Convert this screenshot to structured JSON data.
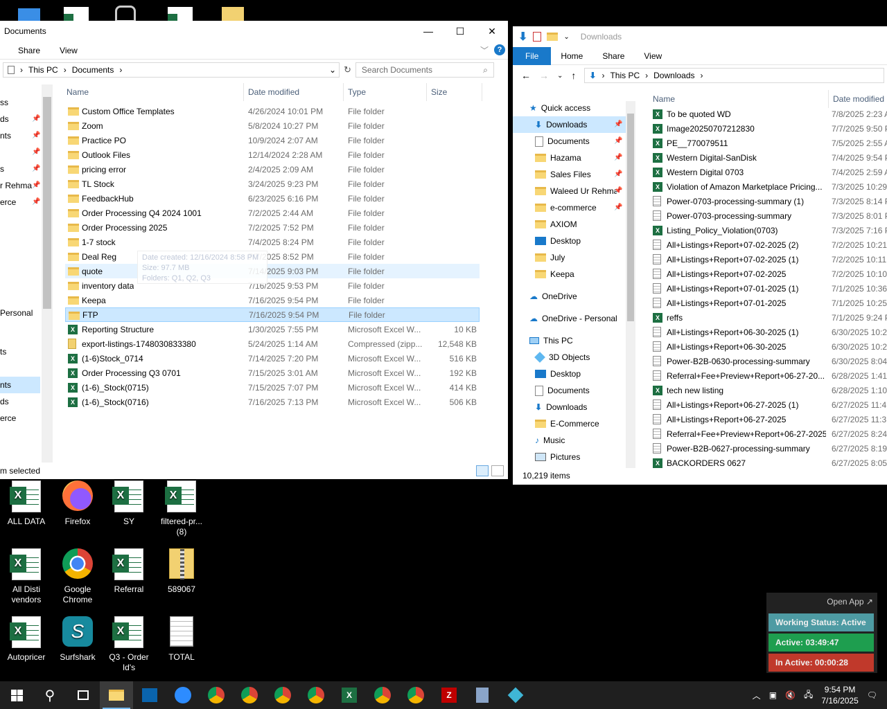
{
  "documents_window": {
    "title": "Documents",
    "tabs": [
      "Share",
      "View"
    ],
    "breadcrumb": [
      "This PC",
      "Documents"
    ],
    "search_placeholder": "Search Documents",
    "nav_partial": [
      "ss",
      "ds",
      "nts",
      "s",
      "r Rehma",
      "erce",
      "Personal",
      "ts",
      "nts",
      "ds",
      "erce"
    ],
    "columns": [
      "Name",
      "Date modified",
      "Type",
      "Size"
    ],
    "files": [
      {
        "name": "Custom Office Templates",
        "date": "4/26/2024 10:01 PM",
        "type": "File folder",
        "size": "",
        "icon": "folder-icon"
      },
      {
        "name": "Zoom",
        "date": "5/8/2024 10:27 PM",
        "type": "File folder",
        "size": "",
        "icon": "folder-icon"
      },
      {
        "name": "Practice PO",
        "date": "10/9/2024 2:07 AM",
        "type": "File folder",
        "size": "",
        "icon": "folder-icon"
      },
      {
        "name": "Outlook Files",
        "date": "12/14/2024 2:28 AM",
        "type": "File folder",
        "size": "",
        "icon": "folder-icon"
      },
      {
        "name": "pricing error",
        "date": "2/4/2025 2:09 AM",
        "type": "File folder",
        "size": "",
        "icon": "folder-icon"
      },
      {
        "name": "TL Stock",
        "date": "3/24/2025 9:23 PM",
        "type": "File folder",
        "size": "",
        "icon": "folder-icon"
      },
      {
        "name": "FeedbackHub",
        "date": "6/23/2025 6:16 PM",
        "type": "File folder",
        "size": "",
        "icon": "folder-icon"
      },
      {
        "name": "Order Processing Q4 2024 1001",
        "date": "7/2/2025 2:44 AM",
        "type": "File folder",
        "size": "",
        "icon": "folder-icon"
      },
      {
        "name": "Order Processing 2025",
        "date": "7/2/2025 7:52 PM",
        "type": "File folder",
        "size": "",
        "icon": "folder-icon"
      },
      {
        "name": "1-7 stock",
        "date": "7/4/2025 8:24 PM",
        "type": "File folder",
        "size": "",
        "icon": "folder-icon"
      },
      {
        "name": "Deal Reg",
        "date": "7/7/2025 8:52 PM",
        "type": "File folder",
        "size": "",
        "icon": "folder-icon"
      },
      {
        "name": "quote",
        "date": "7/14/2025 9:03 PM",
        "type": "File folder",
        "size": "",
        "icon": "folder-icon"
      },
      {
        "name": "inventory data",
        "date": "7/16/2025 9:53 PM",
        "type": "File folder",
        "size": "",
        "icon": "folder-icon"
      },
      {
        "name": "Keepa",
        "date": "7/16/2025 9:54 PM",
        "type": "File folder",
        "size": "",
        "icon": "folder-icon"
      },
      {
        "name": "FTP",
        "date": "7/16/2025 9:54 PM",
        "type": "File folder",
        "size": "",
        "icon": "folder-icon"
      },
      {
        "name": "Reporting Structure",
        "date": "1/30/2025 7:55 PM",
        "type": "Microsoft Excel W...",
        "size": "10 KB",
        "icon": "excel-icon"
      },
      {
        "name": "export-listings-1748030833380",
        "date": "5/24/2025 1:14 AM",
        "type": "Compressed (zipp...",
        "size": "12,548 KB",
        "icon": "zip-icon"
      },
      {
        "name": "(1-6)Stock_0714",
        "date": "7/14/2025 7:20 PM",
        "type": "Microsoft Excel W...",
        "size": "516 KB",
        "icon": "excel-icon"
      },
      {
        "name": "Order Processing Q3 0701",
        "date": "7/15/2025 3:01 AM",
        "type": "Microsoft Excel W...",
        "size": "192 KB",
        "icon": "excel-icon"
      },
      {
        "name": "(1-6)_Stock(0715)",
        "date": "7/15/2025 7:07 PM",
        "type": "Microsoft Excel W...",
        "size": "414 KB",
        "icon": "excel-icon"
      },
      {
        "name": "(1-6)_Stock(0716)",
        "date": "7/16/2025 7:13 PM",
        "type": "Microsoft Excel W...",
        "size": "506 KB",
        "icon": "excel-icon"
      }
    ],
    "tooltip": {
      "created": "Date created: 12/16/2024 8:58 PM",
      "size": "Size: 97.7 MB",
      "folders": "Folders: Q1, Q2, Q3"
    },
    "status": "m selected"
  },
  "downloads_window": {
    "title": "Downloads",
    "tabs": [
      "File",
      "Home",
      "Share",
      "View"
    ],
    "breadcrumb": [
      "This PC",
      "Downloads"
    ],
    "columns": [
      "Name",
      "Date modified"
    ],
    "nav": {
      "quick_access": "Quick access",
      "quick_items": [
        {
          "label": "Downloads",
          "icon": "download-arrow-icon",
          "pinned": true
        },
        {
          "label": "Documents",
          "icon": "documents-icon",
          "pinned": true
        },
        {
          "label": "Hazama",
          "icon": "folder-icon",
          "pinned": true
        },
        {
          "label": "Sales Files",
          "icon": "folder-icon",
          "pinned": true
        },
        {
          "label": "Waleed Ur Rehma",
          "icon": "folder-icon",
          "pinned": true
        },
        {
          "label": "e-commerce",
          "icon": "folder-icon",
          "pinned": true
        },
        {
          "label": "AXIOM",
          "icon": "folder-icon",
          "pinned": false
        },
        {
          "label": "Desktop",
          "icon": "desktop-icon",
          "pinned": false
        },
        {
          "label": "July",
          "icon": "folder-icon",
          "pinned": false
        },
        {
          "label": "Keepa",
          "icon": "folder-icon",
          "pinned": false
        }
      ],
      "onedrive": "OneDrive",
      "onedrive_personal": "OneDrive - Personal",
      "this_pc": "This PC",
      "pc_items": [
        {
          "label": "3D Objects",
          "icon": "3d-objects-icon"
        },
        {
          "label": "Desktop",
          "icon": "desktop-icon"
        },
        {
          "label": "Documents",
          "icon": "documents-icon"
        },
        {
          "label": "Downloads",
          "icon": "download-arrow-icon"
        },
        {
          "label": "E-Commerce",
          "icon": "folder-icon"
        },
        {
          "label": "Music",
          "icon": "music-icon"
        },
        {
          "label": "Pictures",
          "icon": "pictures-icon"
        }
      ]
    },
    "files": [
      {
        "name": "To be quoted WD",
        "date": "7/8/2025 2:23 A",
        "icon": "excel-icon"
      },
      {
        "name": "Image20250707212830",
        "date": "7/7/2025 9:50 P",
        "icon": "excel-icon"
      },
      {
        "name": "PE__770079511",
        "date": "7/5/2025 2:55 A",
        "icon": "excel-icon"
      },
      {
        "name": "Western Digital-SanDisk",
        "date": "7/4/2025 9:54 P",
        "icon": "excel-icon"
      },
      {
        "name": "Western Digital 0703",
        "date": "7/4/2025 2:59 A",
        "icon": "excel-icon"
      },
      {
        "name": "Violation of Amazon Marketplace Pricing...",
        "date": "7/3/2025 10:29",
        "icon": "excel-icon"
      },
      {
        "name": "Power-0703-processing-summary (1)",
        "date": "7/3/2025 8:14 P",
        "icon": "text-icon"
      },
      {
        "name": "Power-0703-processing-summary",
        "date": "7/3/2025 8:01 P",
        "icon": "text-icon"
      },
      {
        "name": "Listing_Policy_Violation(0703)",
        "date": "7/3/2025 7:16 P",
        "icon": "excel-icon"
      },
      {
        "name": "All+Listings+Report+07-02-2025 (2)",
        "date": "7/2/2025 10:21",
        "icon": "text-icon"
      },
      {
        "name": "All+Listings+Report+07-02-2025 (1)",
        "date": "7/2/2025 10:11",
        "icon": "text-icon"
      },
      {
        "name": "All+Listings+Report+07-02-2025",
        "date": "7/2/2025 10:10",
        "icon": "text-icon"
      },
      {
        "name": "All+Listings+Report+07-01-2025 (1)",
        "date": "7/1/2025 10:36",
        "icon": "text-icon"
      },
      {
        "name": "All+Listings+Report+07-01-2025",
        "date": "7/1/2025 10:25",
        "icon": "text-icon"
      },
      {
        "name": "reffs",
        "date": "7/1/2025 9:24 P",
        "icon": "excel-icon"
      },
      {
        "name": "All+Listings+Report+06-30-2025 (1)",
        "date": "6/30/2025 10:2",
        "icon": "text-icon"
      },
      {
        "name": "All+Listings+Report+06-30-2025",
        "date": "6/30/2025 10:2",
        "icon": "text-icon"
      },
      {
        "name": "Power-B2B-0630-processing-summary",
        "date": "6/30/2025 8:04",
        "icon": "text-icon"
      },
      {
        "name": "Referral+Fee+Preview+Report+06-27-20...",
        "date": "6/28/2025 1:41",
        "icon": "text-icon"
      },
      {
        "name": "tech new listing",
        "date": "6/28/2025 1:10",
        "icon": "excel-icon"
      },
      {
        "name": "All+Listings+Report+06-27-2025 (1)",
        "date": "6/27/2025 11:4",
        "icon": "text-icon"
      },
      {
        "name": "All+Listings+Report+06-27-2025",
        "date": "6/27/2025 11:3",
        "icon": "text-icon"
      },
      {
        "name": "Referral+Fee+Preview+Report+06-27-2025",
        "date": "6/27/2025 8:24",
        "icon": "text-icon"
      },
      {
        "name": "Power-B2B-0627-processing-summary",
        "date": "6/27/2025 8:19",
        "icon": "text-icon"
      },
      {
        "name": "BACKORDERS 0627",
        "date": "6/27/2025 8:05",
        "icon": "excel-icon"
      }
    ],
    "status": "10,219 items"
  },
  "desktop_icons": [
    {
      "label": "ALL DATA",
      "icon": "excel-icon"
    },
    {
      "label": "Firefox",
      "icon": "firefox-icon"
    },
    {
      "label": "SY",
      "icon": "excel-icon"
    },
    {
      "label": "filtered-pr... (8)",
      "icon": "excel-icon"
    },
    {
      "label": "All Disti vendors",
      "icon": "excel-icon"
    },
    {
      "label": "Google Chrome",
      "icon": "chrome-icon"
    },
    {
      "label": "Referral",
      "icon": "excel-icon"
    },
    {
      "label": "589067",
      "icon": "zip-icon"
    },
    {
      "label": "Autopricer",
      "icon": "excel-icon"
    },
    {
      "label": "Surfshark",
      "icon": "surfshark-icon"
    },
    {
      "label": "Q3 - Order Id's",
      "icon": "excel-icon"
    },
    {
      "label": "TOTAL",
      "icon": "text-icon"
    }
  ],
  "widget": {
    "open_app": "Open App ↗",
    "status": "Working Status: Active",
    "active": "Active: 03:49:47",
    "inactive": "In Active: 00:00:28",
    "colors": {
      "status": "#4e9ba3",
      "active": "#1e9e4f",
      "inactive": "#c0392b"
    }
  },
  "taskbar": {
    "time": "9:54 PM",
    "date": "7/16/2025"
  }
}
